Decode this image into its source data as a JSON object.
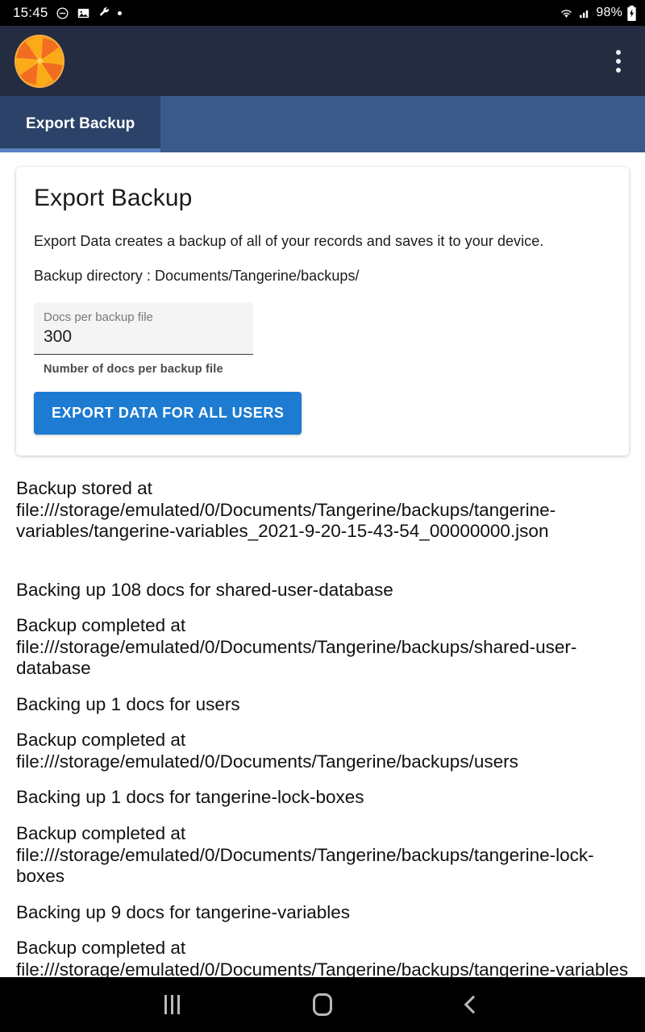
{
  "statusbar": {
    "time": "15:45",
    "icons_left": [
      "do-not-disturb-icon",
      "image-icon",
      "wrench-icon",
      "dot-icon"
    ],
    "wifi": "wifi-icon",
    "signal": "cellular-signal-icon",
    "battery_text": "98%",
    "battery_icon": "battery-charging-icon"
  },
  "appbar": {
    "logo": "tangerine-logo-icon",
    "overflow_menu": "more-vertical-icon",
    "background_color": "#242c42"
  },
  "tabs": [
    {
      "label": "Export Backup",
      "active": true
    }
  ],
  "card": {
    "title": "Export Backup",
    "description": "Export Data creates a backup of all of your records and saves it to your device.",
    "backup_directory_line": "Backup directory : Documents/Tangerine/backups/",
    "field": {
      "label": "Docs per backup file",
      "value": "300",
      "placeholder": "Docs per backup file",
      "hint": "Number of docs per backup file"
    },
    "export_button": "EXPORT DATA FOR ALL USERS",
    "accent_color": "#1d7bd1"
  },
  "log": [
    {
      "text": "Backup stored at file:///storage/emulated/0/Documents/Tangerine/backups/tangerine-variables/tangerine-variables_2021-9-20-15-43-54_00000000.json"
    },
    {
      "text": ""
    },
    {
      "text": "Backing up 108 docs for shared-user-database"
    },
    {
      "text": "Backup completed at file:///storage/emulated/0/Documents/Tangerine/backups/shared-user-database"
    },
    {
      "text": "Backing up 1 docs for users"
    },
    {
      "text": "Backup completed at file:///storage/emulated/0/Documents/Tangerine/backups/users"
    },
    {
      "text": "Backing up 1 docs for tangerine-lock-boxes"
    },
    {
      "text": "Backup completed at file:///storage/emulated/0/Documents/Tangerine/backups/tangerine-lock-boxes"
    },
    {
      "text": "Backing up 9 docs for tangerine-variables"
    },
    {
      "text": "Backup completed at file:///storage/emulated/0/Documents/Tangerine/backups/tangerine-variables"
    }
  ],
  "navbar": {
    "recents": "recents-icon",
    "home": "home-icon",
    "back": "back-icon"
  }
}
